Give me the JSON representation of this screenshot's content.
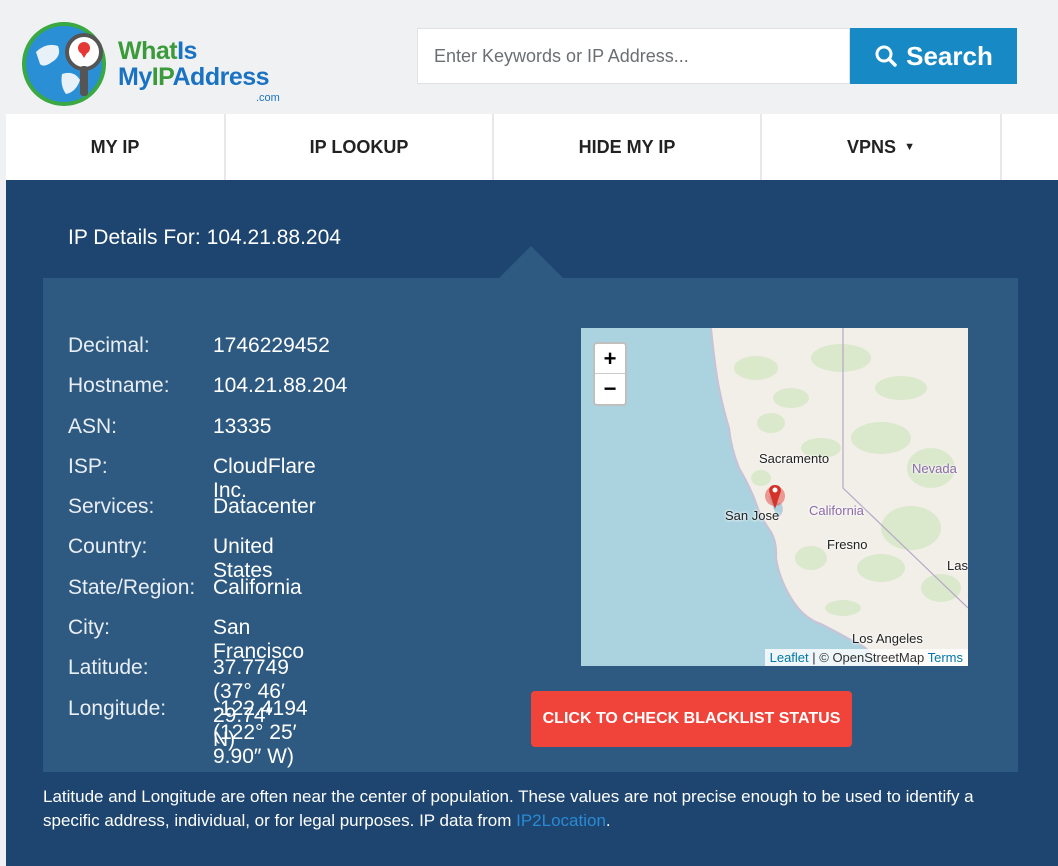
{
  "header": {
    "logo": {
      "line1_a": "What",
      "line1_b": "Is",
      "line2_a": "My",
      "line2_b": "IP",
      "line2_c": "Address",
      "suffix": ".com"
    },
    "search": {
      "placeholder": "Enter Keywords or IP Address...",
      "button_label": "Search"
    }
  },
  "nav": {
    "items": [
      {
        "label": "MY IP"
      },
      {
        "label": "IP LOOKUP"
      },
      {
        "label": "HIDE MY IP"
      },
      {
        "label": "VPNS",
        "caret": "▼"
      }
    ]
  },
  "details": {
    "heading_label": "IP Details For:",
    "ip": "104.21.88.204",
    "rows": [
      {
        "label": "Decimal:",
        "value": "1746229452"
      },
      {
        "label": "Hostname:",
        "value": "104.21.88.204"
      },
      {
        "label": "ASN:",
        "value": "13335"
      },
      {
        "label": "ISP:",
        "value": "CloudFlare Inc."
      },
      {
        "label": "Services:",
        "value": "Datacenter"
      },
      {
        "label": "Country:",
        "value": "United States"
      },
      {
        "label": "State/Region:",
        "value": "California"
      },
      {
        "label": "City:",
        "value": "San Francisco"
      },
      {
        "label": "Latitude:",
        "value": "37.7749  (37° 46′ 29.74″ N)"
      },
      {
        "label": "Longitude:",
        "value": "-122.4194  (122° 25′ 9.90″ W)"
      }
    ],
    "blacklist_button": "CLICK TO CHECK BLACKLIST STATUS"
  },
  "map": {
    "zoom_in": "+",
    "zoom_out": "−",
    "labels": {
      "sacramento": "Sacramento",
      "nevada": "Nevada",
      "san_jose": "San Jose",
      "california": "California",
      "fresno": "Fresno",
      "las": "Las",
      "los_angeles": "Los Angeles"
    },
    "attribution": {
      "leaflet": "Leaflet",
      "sep": " | © OpenStreetMap ",
      "terms": "Terms"
    }
  },
  "footnote": {
    "text": "Latitude and Longitude are often near the center of population. These values are not precise enough to be used to identify a specific address, individual, or for legal purposes. IP data from ",
    "link": "IP2Location",
    "end": "."
  },
  "colors": {
    "panel": "#1d4570",
    "box": "#2e5a82",
    "search_button": "#1789c5",
    "blacklist_button": "#f0433a"
  }
}
